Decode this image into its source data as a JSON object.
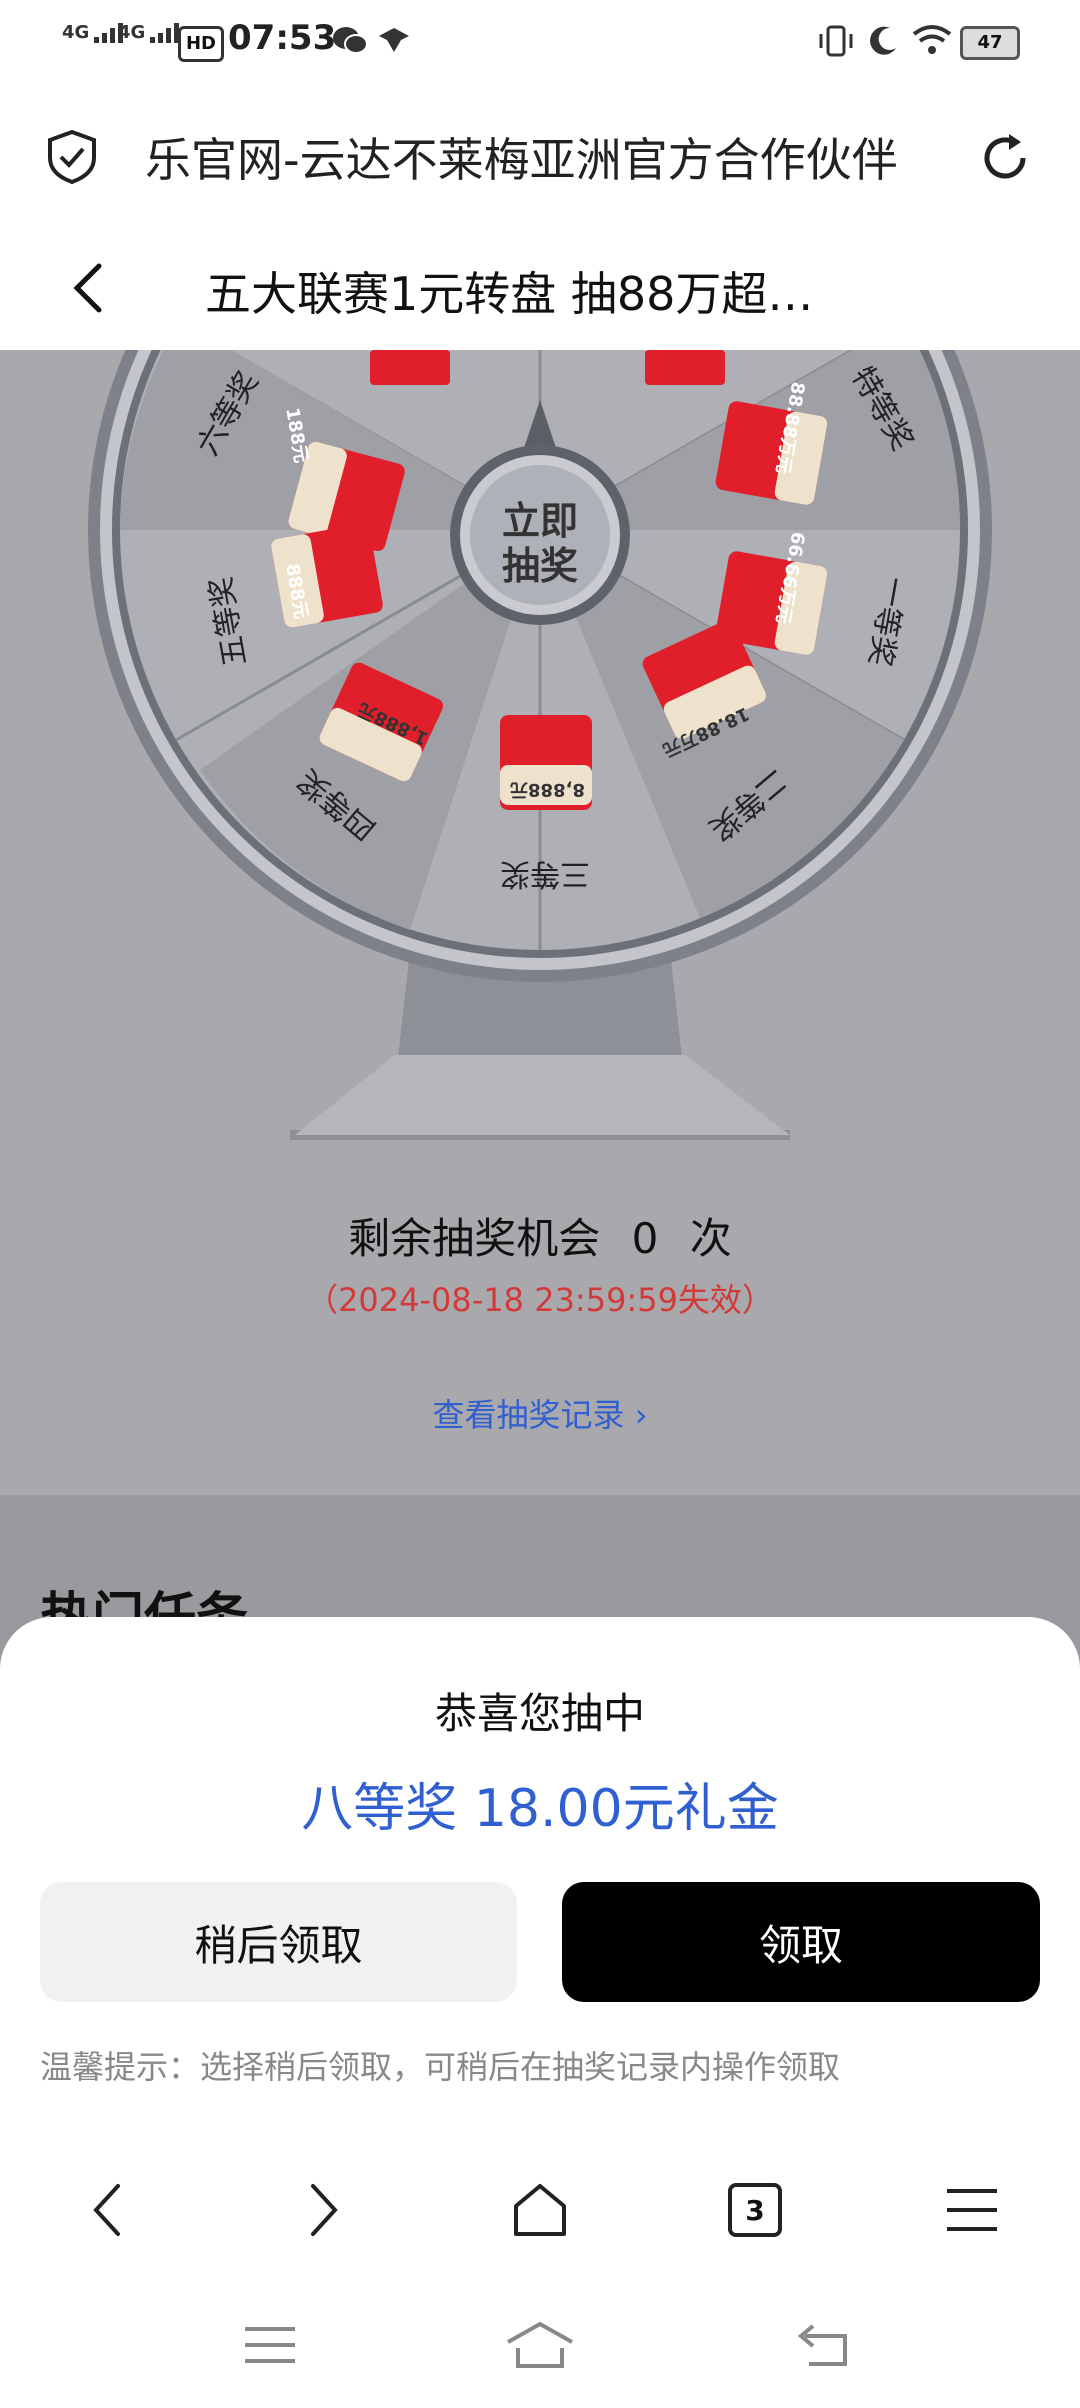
{
  "status": {
    "network1": "4G",
    "network2": "4G",
    "hd": "HD",
    "time": "07:53",
    "battery": "47"
  },
  "urlbar": {
    "url_text": "乐官网-云达不莱梅亚洲官方合作伙伴"
  },
  "header": {
    "title": "五大联赛1元转盘 抽88万超…"
  },
  "wheel": {
    "center_label_1": "立即",
    "center_label_2": "抽奖",
    "segments": [
      {
        "label": "特等奖",
        "amount": "88.88万元"
      },
      {
        "label": "一等奖",
        "amount": "66.66万元"
      },
      {
        "label": "二等奖",
        "amount": "18.88万元"
      },
      {
        "label": "三等奖",
        "amount": "8,888元"
      },
      {
        "label": "四等奖",
        "amount": "1,888元"
      },
      {
        "label": "五等奖",
        "amount": "888元"
      },
      {
        "label": "六等奖",
        "amount": "188元"
      }
    ]
  },
  "lottery": {
    "chances_prefix": "剩余抽奖机会",
    "chances_count": "0",
    "chances_suffix": "次",
    "validity": "（2024-08-18 23:59:59失效）",
    "record_link": "查看抽奖记录",
    "hot_tasks": "热门任务"
  },
  "sheet": {
    "congrats": "恭喜您抽中",
    "prize": "八等奖 18.00元礼金",
    "later_label": "稍后领取",
    "claim_label": "领取",
    "tip": "温馨提示：选择稍后领取，可稍后在抽奖记录内操作领取"
  },
  "toolbar": {
    "tab_count": "3"
  },
  "colors": {
    "accent_blue": "#2f5fd0",
    "warning_red": "#d23a3a",
    "envelope_red": "#e01f2b",
    "overlay_gray": "#a9a9ad"
  }
}
